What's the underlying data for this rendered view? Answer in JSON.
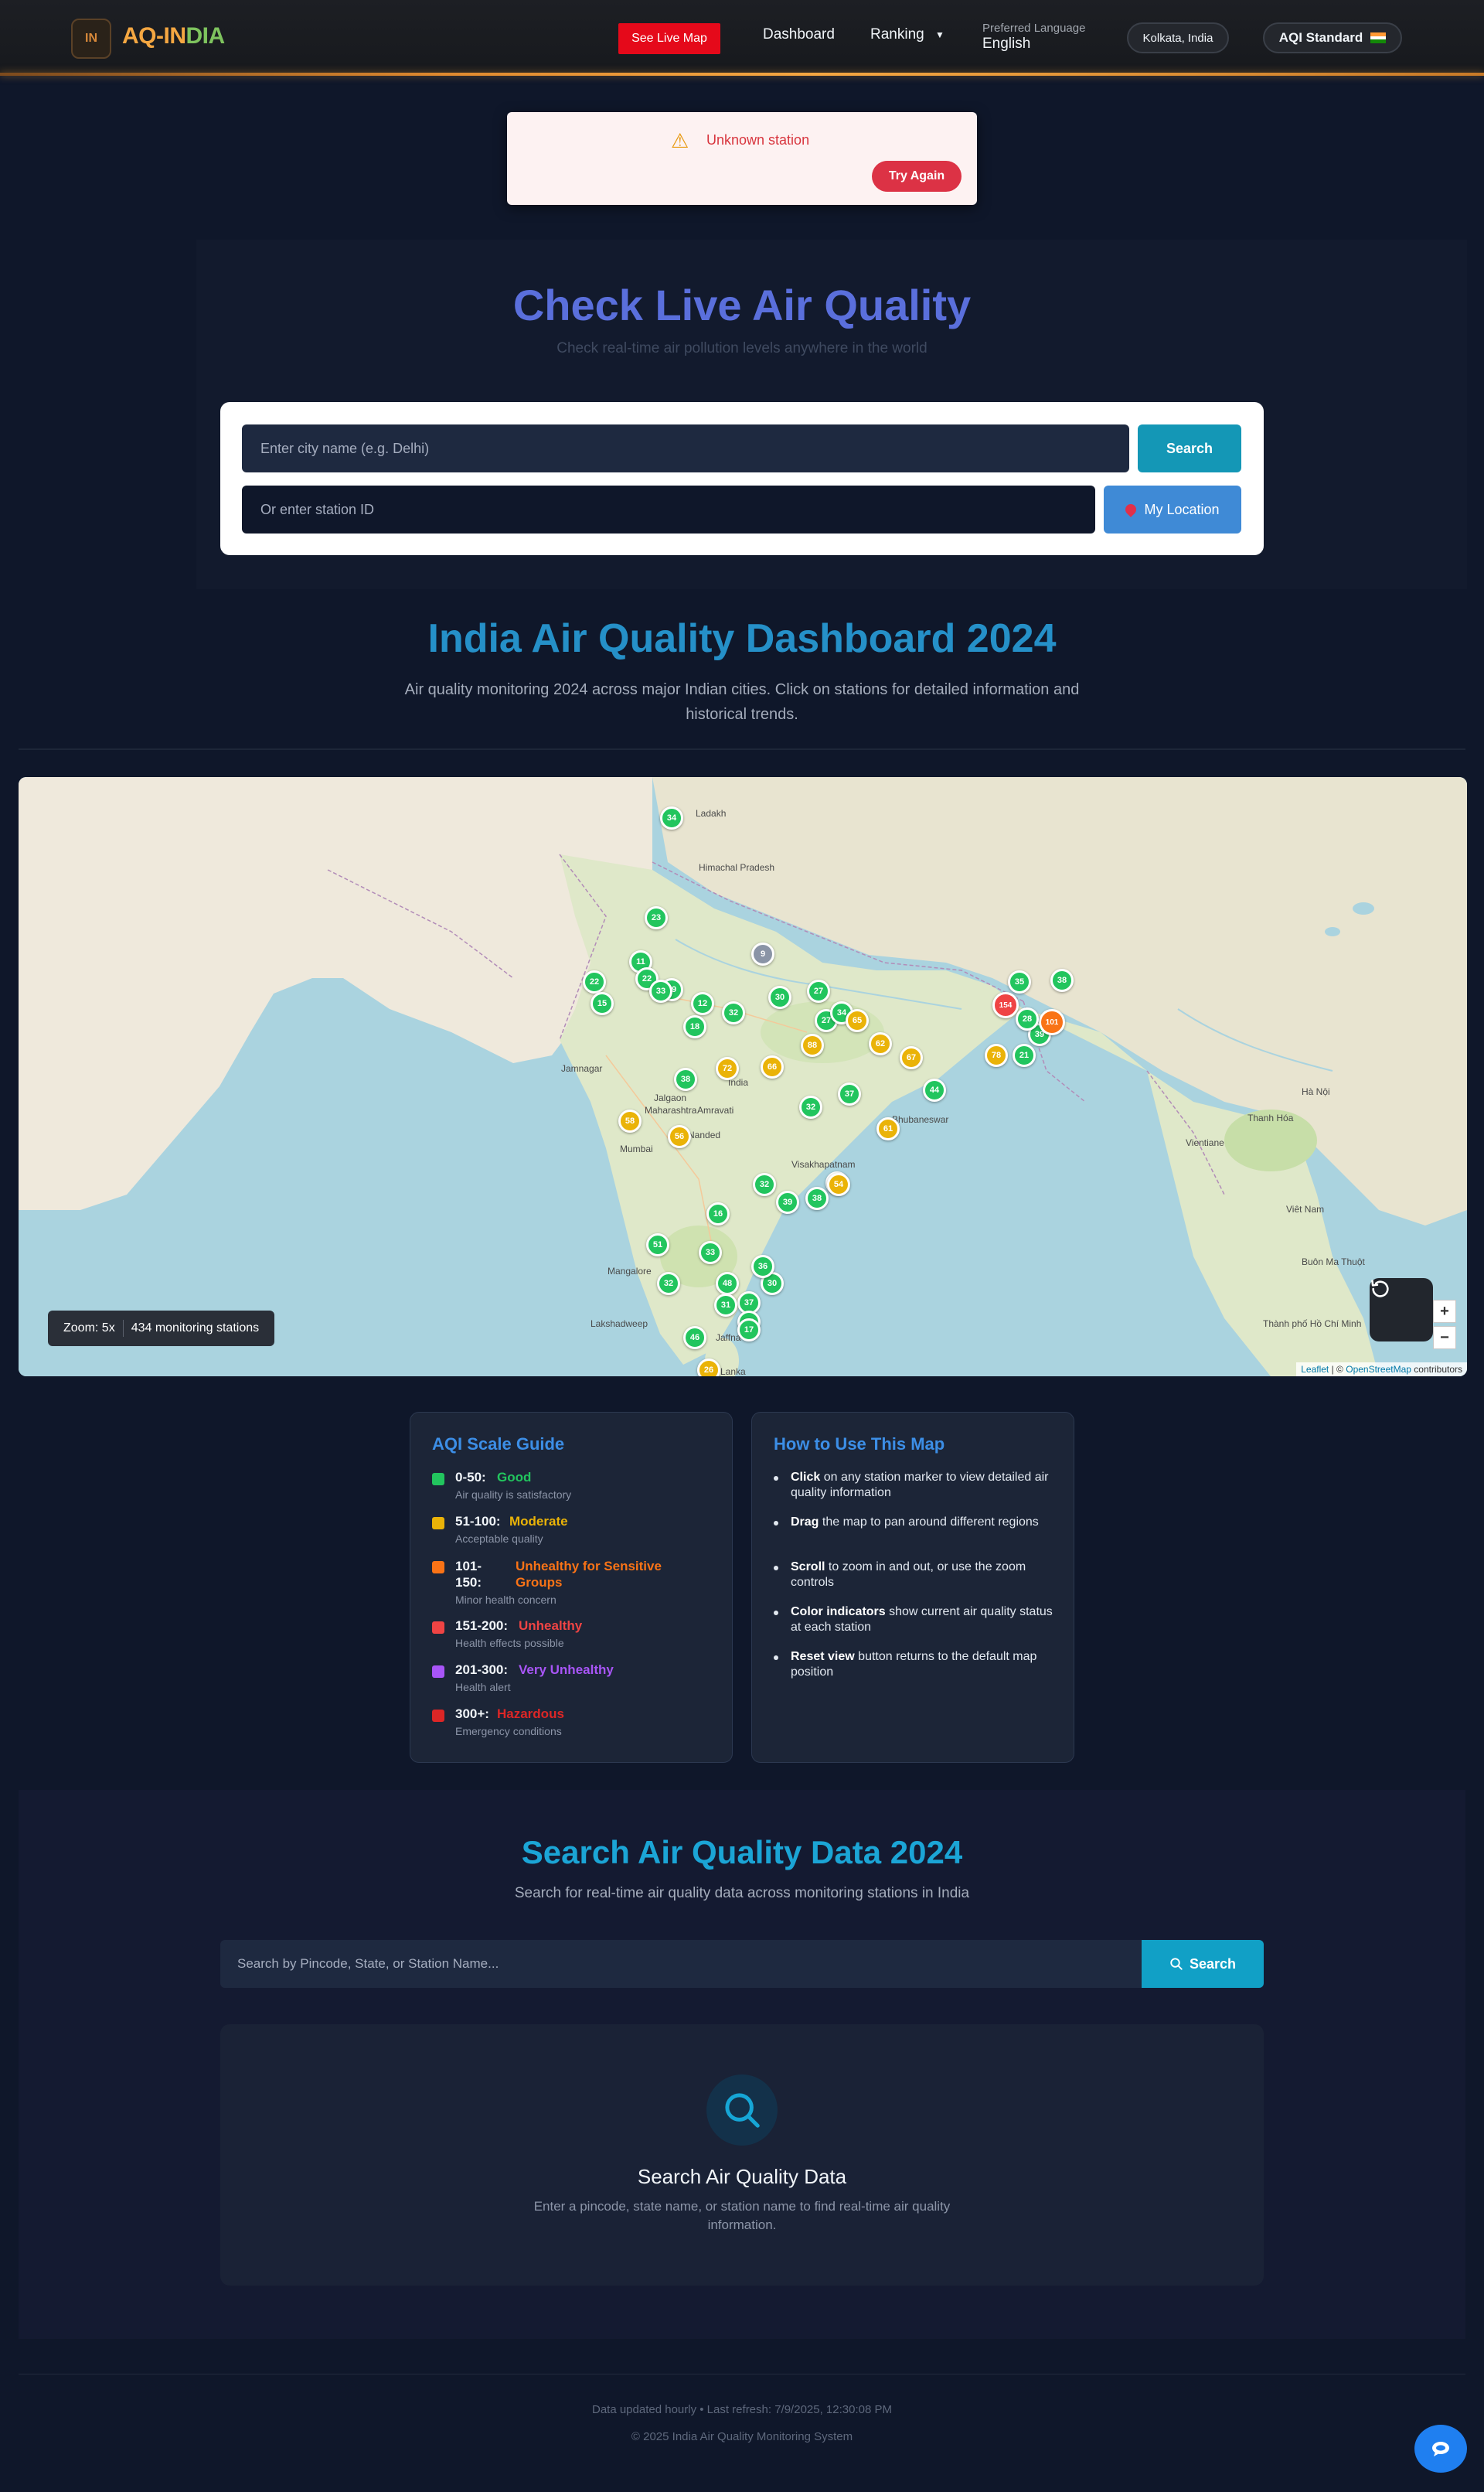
{
  "navbar": {
    "logo_badge": "IN",
    "logo_part1": "AQ-IN",
    "logo_part2": "DIA",
    "live_map_label": "See Live Map",
    "dashboard_label": "Dashboard",
    "ranking_label": "Ranking",
    "language_label": "Preferred Language",
    "language_value": "English",
    "location": "Kolkata, India",
    "aqi_standard": "AQI Standard"
  },
  "error": {
    "message": "Unknown station",
    "retry_label": "Try Again"
  },
  "check": {
    "title": "Check Live Air Quality",
    "subtitle": "Check real-time air pollution levels anywhere in the world",
    "city_placeholder": "Enter city name (e.g. Delhi)",
    "search_label": "Search",
    "station_placeholder": "Or enter station ID",
    "location_label": "My Location"
  },
  "dashboard": {
    "title": "India Air Quality Dashboard 2024",
    "description": "Air quality monitoring 2024 across major Indian cities. Click on stations for detailed information and historical trends."
  },
  "map": {
    "zoom_text": "Zoom: 5x",
    "stations_text": "434 monitoring stations",
    "zoom_in": "+",
    "zoom_out": "−",
    "attribution_leaflet": "Leaflet",
    "attribution_osm": "OpenStreetMap",
    "attribution_rest": "contributors",
    "attribution_sep": "| ©",
    "labels": [
      "Jamnagar",
      "Jalgaon",
      "Amravati",
      "Nanded",
      "Mumbai",
      "India",
      "Bhubaneswar",
      "Visakhapatnam",
      "Mangalore",
      "Jaffna",
      "Sri Lanka",
      "Thanh Hóa",
      "Viêt Nam",
      "Buôn Ma Thuột",
      "Thành phố Hồ Chí Minh",
      "Hà Nội",
      "Vientiane",
      "Lakshadweep",
      "Maharashtra",
      "Ladakh",
      "Himachal Pradesh"
    ],
    "markers": [
      {
        "v": "34",
        "c": "green"
      },
      {
        "v": "23",
        "c": "green"
      },
      {
        "v": "22",
        "c": "green"
      },
      {
        "v": "11",
        "c": "green"
      },
      {
        "v": "22",
        "c": "green"
      },
      {
        "v": "15",
        "c": "green"
      },
      {
        "v": "49",
        "c": "green"
      },
      {
        "v": "12",
        "c": "green"
      },
      {
        "v": "18",
        "c": "green"
      },
      {
        "v": "32",
        "c": "green"
      },
      {
        "v": "30",
        "c": "green"
      },
      {
        "v": "27",
        "c": "green"
      },
      {
        "v": "34",
        "c": "green"
      },
      {
        "v": "65",
        "c": "yellow"
      },
      {
        "v": "72",
        "c": "yellow"
      },
      {
        "v": "66",
        "c": "yellow"
      },
      {
        "v": "88",
        "c": "yellow"
      },
      {
        "v": "67",
        "c": "yellow"
      },
      {
        "v": "32",
        "c": "green"
      },
      {
        "v": "37",
        "c": "green"
      },
      {
        "v": "44",
        "c": "green"
      },
      {
        "v": "61",
        "c": "yellow"
      },
      {
        "v": "58",
        "c": "yellow"
      },
      {
        "v": "38",
        "c": "green"
      },
      {
        "v": "56",
        "c": "yellow"
      },
      {
        "v": "154",
        "c": "red"
      },
      {
        "v": "38",
        "c": "green"
      },
      {
        "v": "39",
        "c": "green"
      },
      {
        "v": "101",
        "c": "orange"
      },
      {
        "v": "78",
        "c": "yellow"
      },
      {
        "v": "21",
        "c": "green"
      },
      {
        "v": "32",
        "c": "green"
      },
      {
        "v": "39",
        "c": "green"
      },
      {
        "v": "38",
        "c": "green"
      },
      {
        "v": "16",
        "c": "green"
      },
      {
        "v": "51",
        "c": "green"
      },
      {
        "v": "33",
        "c": "green"
      },
      {
        "v": "32",
        "c": "green"
      },
      {
        "v": "48",
        "c": "green"
      },
      {
        "v": "30",
        "c": "green"
      },
      {
        "v": "46",
        "c": "green"
      },
      {
        "v": "37",
        "c": "green"
      },
      {
        "v": "26",
        "c": "yellow"
      },
      {
        "v": "54",
        "c": "yellow"
      },
      {
        "v": "31",
        "c": "green"
      },
      {
        "v": "25",
        "c": "green"
      },
      {
        "v": "36",
        "c": "green"
      },
      {
        "v": "17",
        "c": "green"
      },
      {
        "v": "9",
        "c": "gray"
      },
      {
        "v": "54",
        "c": "yellow"
      },
      {
        "v": "62",
        "c": "yellow"
      },
      {
        "v": "35",
        "c": "green"
      },
      {
        "v": "28",
        "c": "green"
      },
      {
        "v": "27",
        "c": "green"
      },
      {
        "v": "33",
        "c": "green"
      }
    ]
  },
  "guide": {
    "title": "AQI Scale Guide",
    "items": [
      {
        "range": "0-50:",
        "name": "Good",
        "desc": "Air quality is satisfactory",
        "color": "#22c55e"
      },
      {
        "range": "51-100:",
        "name": "Moderate",
        "desc": "Acceptable quality",
        "color": "#eab308"
      },
      {
        "range": "101-150:",
        "name": "Unhealthy for Sensitive Groups",
        "desc": "Minor health concern",
        "color": "#f97316"
      },
      {
        "range": "151-200:",
        "name": "Unhealthy",
        "desc": "Health effects possible",
        "color": "#ef4444"
      },
      {
        "range": "201-300:",
        "name": "Very Unhealthy",
        "desc": "Health alert",
        "color": "#a855f7"
      },
      {
        "range": "300+:",
        "name": "Hazardous",
        "desc": "Emergency conditions",
        "color": "#dc2626"
      }
    ]
  },
  "howto": {
    "title": "How to Use This Map",
    "items": [
      {
        "bold": "Click",
        "rest": " on any station marker to view detailed air quality information"
      },
      {
        "bold": "Drag",
        "rest": " the map to pan around different regions"
      },
      {
        "bold": "Scroll",
        "rest": " to zoom in and out, or use the zoom controls"
      },
      {
        "bold": "Color indicators",
        "rest": " show current air quality status at each station"
      },
      {
        "bold": "Reset view",
        "rest": " button returns to the default map position"
      }
    ]
  },
  "search_data": {
    "title": "Search Air Quality Data 2024",
    "subtitle": "Search for real-time air quality data across monitoring stations in India",
    "placeholder": "Search by Pincode, State, or Station Name...",
    "button_label": "Search",
    "card_title": "Search Air Quality Data",
    "card_desc": "Enter a pincode, state name, or station name to find real-time air quality information."
  },
  "footer": {
    "updated": "Data updated hourly • Last refresh: 7/9/2025, 12:30:08 PM",
    "copyright": "© 2025 India Air Quality Monitoring System"
  },
  "colors": {
    "good": "#22c55e",
    "moderate": "#eab308",
    "sensitive": "#f97316",
    "unhealthy": "#ef4444",
    "very_unhealthy": "#a855f7",
    "hazardous": "#dc2626",
    "accent": "#1497b6"
  }
}
